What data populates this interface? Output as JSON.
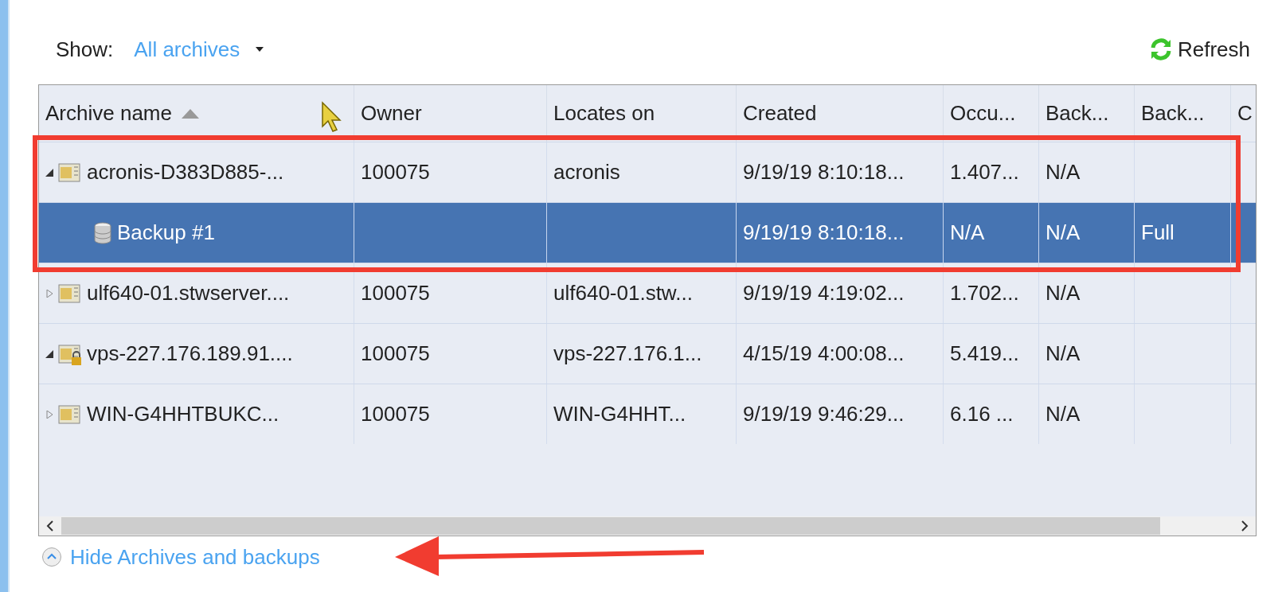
{
  "toolbar": {
    "show_label": "Show:",
    "show_value": "All archives",
    "refresh": "Refresh"
  },
  "table": {
    "columns": [
      {
        "label": "Archive name",
        "sorted": true
      },
      {
        "label": "Owner",
        "sorted": false
      },
      {
        "label": "Locates on",
        "sorted": false
      },
      {
        "label": "Created",
        "sorted": false
      },
      {
        "label": "Occu...",
        "sorted": false
      },
      {
        "label": "Back...",
        "sorted": false
      },
      {
        "label": "Back...",
        "sorted": false
      },
      {
        "label": "C",
        "sorted": false
      }
    ],
    "rows": [
      {
        "kind": "archive",
        "expanded": true,
        "selected": false,
        "name": "acronis-D383D885-...",
        "owner": "100075",
        "locates_on": "acronis",
        "created": "9/19/19 8:10:18...",
        "occupied": "1.407...",
        "column_6": "N/A",
        "children": [
          {
            "kind": "backup",
            "selected": true,
            "name": "Backup #1",
            "created": "9/19/19 8:10:18...",
            "occupied": "N/A",
            "column_6": "N/A",
            "column_7": "Full"
          }
        ]
      },
      {
        "kind": "archive",
        "expanded": false,
        "selected": false,
        "name": "ulf640-01.stwserver....",
        "owner": "100075",
        "locates_on": "ulf640-01.stw...",
        "created": "9/19/19 4:19:02...",
        "occupied": "1.702...",
        "column_6": "N/A"
      },
      {
        "kind": "locked-archive",
        "expanded": true,
        "selected": false,
        "name": "vps-227.176.189.91....",
        "owner": "100075",
        "locates_on": "vps-227.176.1...",
        "created": "4/15/19 4:00:08...",
        "occupied": "5.419...",
        "column_6": "N/A"
      },
      {
        "kind": "archive",
        "expanded": false,
        "selected": false,
        "name": "WIN-G4HHTBUKC...",
        "owner": "100075",
        "locates_on": "WIN-G4HHT...",
        "created": "9/19/19 9:46:29...",
        "occupied": "6.16 ...",
        "column_6": "N/A"
      }
    ]
  },
  "footer_link": "Hide Archives and backups"
}
